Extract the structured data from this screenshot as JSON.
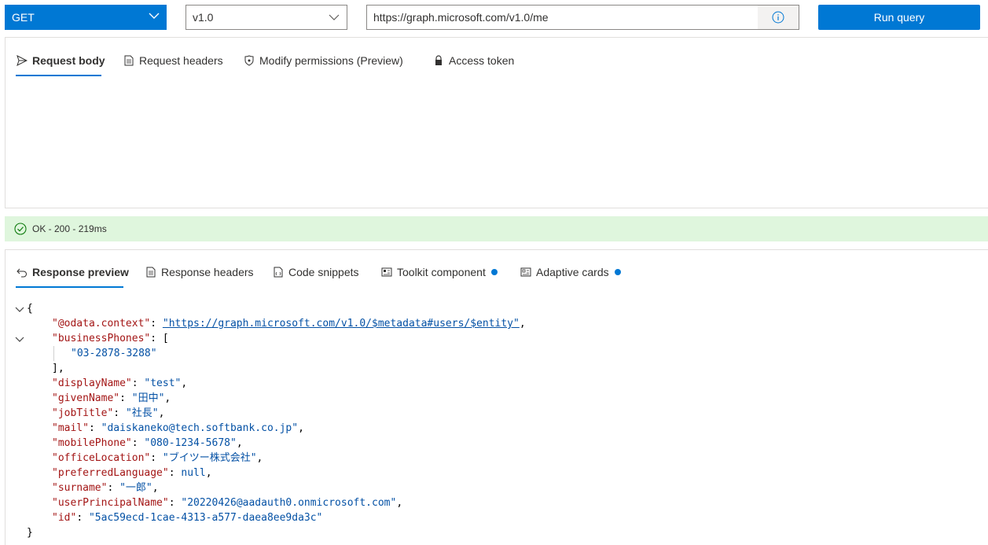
{
  "query": {
    "method": "GET",
    "version": "v1.0",
    "url": "https://graph.microsoft.com/v1.0/me",
    "run_label": "Run query"
  },
  "request_tabs": [
    {
      "label": "Request body",
      "icon": "send-icon",
      "active": true
    },
    {
      "label": "Request headers",
      "icon": "document-icon",
      "active": false
    },
    {
      "label": "Modify permissions (Preview)",
      "icon": "shield-icon",
      "active": false
    },
    {
      "label": "Access token",
      "icon": "lock-icon",
      "active": false
    }
  ],
  "status": {
    "text": "OK - 200 - 219ms",
    "color": "#dff6dd"
  },
  "response_tabs": [
    {
      "label": "Response preview",
      "icon": "undo-icon",
      "active": true
    },
    {
      "label": "Response headers",
      "icon": "document-icon",
      "active": false
    },
    {
      "label": "Code snippets",
      "icon": "code-icon",
      "active": false
    },
    {
      "label": "Toolkit component",
      "icon": "toolkit-icon",
      "active": false,
      "badge": true
    },
    {
      "label": "Adaptive cards",
      "icon": "card-icon",
      "active": false,
      "badge": true
    }
  ],
  "response_json": {
    "open_brace": "{",
    "close_brace": "}",
    "odata_key": "\"@odata.context\"",
    "odata_value": "\"https://graph.microsoft.com/v1.0/$metadata#users/$entity\"",
    "phones_key": "\"businessPhones\"",
    "phones_open": "[",
    "phones_item": "\"03-2878-3288\"",
    "phones_close": "],",
    "fields": [
      {
        "key": "\"displayName\"",
        "value": "\"test\"",
        "comma": ","
      },
      {
        "key": "\"givenName\"",
        "value": "\"田中\"",
        "comma": ","
      },
      {
        "key": "\"jobTitle\"",
        "value": "\"社長\"",
        "comma": ","
      },
      {
        "key": "\"mail\"",
        "value": "\"daiskaneko@tech.softbank.co.jp\"",
        "comma": ","
      },
      {
        "key": "\"mobilePhone\"",
        "value": "\"080-1234-5678\"",
        "comma": ","
      },
      {
        "key": "\"officeLocation\"",
        "value": "\"ブイツー株式会社\"",
        "comma": ","
      },
      {
        "key": "\"preferredLanguage\"",
        "value": "null",
        "comma": ","
      },
      {
        "key": "\"surname\"",
        "value": "\"一郎\"",
        "comma": ","
      },
      {
        "key": "\"userPrincipalName\"",
        "value": "\"20220426@aadauth0.onmicrosoft.com\"",
        "comma": ","
      },
      {
        "key": "\"id\"",
        "value": "\"5ac59ecd-1cae-4313-a577-daea8ee9da3c\"",
        "comma": ""
      }
    ]
  },
  "colors": {
    "accent": "#0078d4",
    "json_key": "#a31515",
    "json_string": "#0451a5"
  }
}
